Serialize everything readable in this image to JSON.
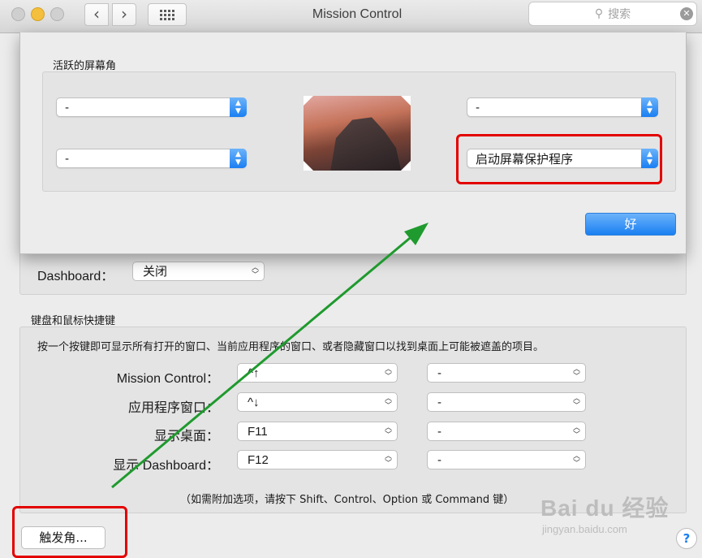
{
  "window": {
    "title": "Mission Control",
    "search_placeholder": "搜索"
  },
  "sheet": {
    "section_label": "活跃的屏幕角",
    "corners": {
      "top_left": "-",
      "bottom_left": "-",
      "top_right": "-",
      "bottom_right": "启动屏幕保护程序"
    },
    "ok_label": "好"
  },
  "dashboard": {
    "label": "Dashboard：",
    "value": "关闭"
  },
  "shortcuts": {
    "title": "键盘和鼠标快捷键",
    "description": "按一个按键即可显示所有打开的窗口、当前应用程序的窗口、或者隐藏窗口以找到桌面上可能被遮盖的项目。",
    "rows": [
      {
        "label": "Mission Control：",
        "key": "^↑",
        "mouse": "-"
      },
      {
        "label": "应用程序窗口：",
        "key": "^↓",
        "mouse": "-"
      },
      {
        "label": "显示桌面：",
        "key": "F11",
        "mouse": "-"
      },
      {
        "label": "显示 Dashboard：",
        "key": "F12",
        "mouse": "-"
      }
    ],
    "hint": "（如需附加选项，请按下 Shift、Control、Option 或 Command 键）"
  },
  "footer": {
    "hot_corners_button": "触发角...",
    "help": "?"
  },
  "watermark": {
    "brand": "Bai du 经验",
    "url": "jingyan.baidu.com"
  },
  "colors": {
    "accent": "#1a7ff2",
    "highlight_box": "#e30000",
    "annotation_arrow": "#1f9a2e"
  }
}
